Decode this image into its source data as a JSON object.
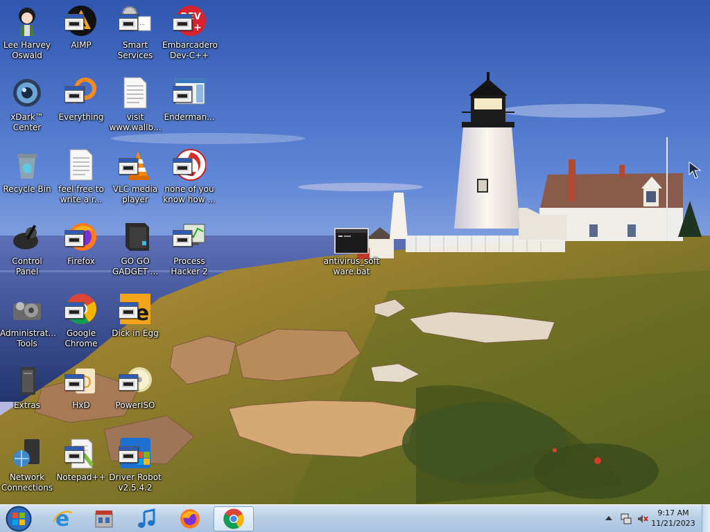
{
  "desktop": {
    "icons": [
      {
        "label": "Lee Harvey Oswald",
        "icon": "anime-character-icon"
      },
      {
        "label": "AIMP",
        "icon": "aimp-icon"
      },
      {
        "label": "Smart Services",
        "icon": "gears-icon"
      },
      {
        "label": "Embarcadero Dev-C++",
        "icon": "devcpp-icon"
      },
      {
        "label": "xDark™ Center",
        "icon": "xdark-orb-icon"
      },
      {
        "label": "Everything",
        "icon": "everything-search-icon"
      },
      {
        "label": "visit www.wallb...",
        "icon": "text-document-icon"
      },
      {
        "label": "Enderman...",
        "icon": "window-shortcut-icon"
      },
      {
        "label": "Recycle Bin",
        "icon": "recycle-bin-icon"
      },
      {
        "label": "feel free to write a r...",
        "icon": "text-document-icon"
      },
      {
        "label": "VLC media player",
        "icon": "vlc-cone-icon"
      },
      {
        "label": "none of you know how ...",
        "icon": "red-swirl-icon"
      },
      {
        "label": "Control Panel",
        "icon": "control-panel-icon"
      },
      {
        "label": "Firefox",
        "icon": "firefox-icon"
      },
      {
        "label": "GO GO GADGET ...",
        "icon": "computer-case-icon"
      },
      {
        "label": "Process Hacker 2",
        "icon": "process-hacker-icon"
      },
      {
        "label": "Administrat... Tools",
        "icon": "admin-tools-icon"
      },
      {
        "label": "Google Chrome",
        "icon": "chrome-icon"
      },
      {
        "label": "Dick in Egg",
        "icon": "orange-e-icon"
      },
      {
        "label": "Extras",
        "icon": "extras-folder-icon"
      },
      {
        "label": "HxD",
        "icon": "hxd-icon"
      },
      {
        "label": "PowerISO",
        "icon": "disc-icon"
      },
      {
        "label": "Network Connections",
        "icon": "network-icon"
      },
      {
        "label": "Notepad++",
        "icon": "notepad-plus-icon"
      },
      {
        "label": "Driver Robot v2.5.4.2",
        "icon": "driver-robot-icon"
      },
      {
        "label": "antivirus_software.bat",
        "icon": "batch-file-icon"
      }
    ]
  },
  "taskbar": {
    "items": [
      {
        "name": "internet-explorer",
        "icon": "internet-explorer-icon",
        "active": false
      },
      {
        "name": "store",
        "icon": "store-icon",
        "active": false
      },
      {
        "name": "media-player",
        "icon": "music-note-icon",
        "active": false
      },
      {
        "name": "firefox",
        "icon": "firefox-icon",
        "active": false
      },
      {
        "name": "chrome",
        "icon": "chrome-icon",
        "active": true
      }
    ],
    "clock": {
      "time": "9:17 AM",
      "date": "11/21/2023"
    }
  }
}
